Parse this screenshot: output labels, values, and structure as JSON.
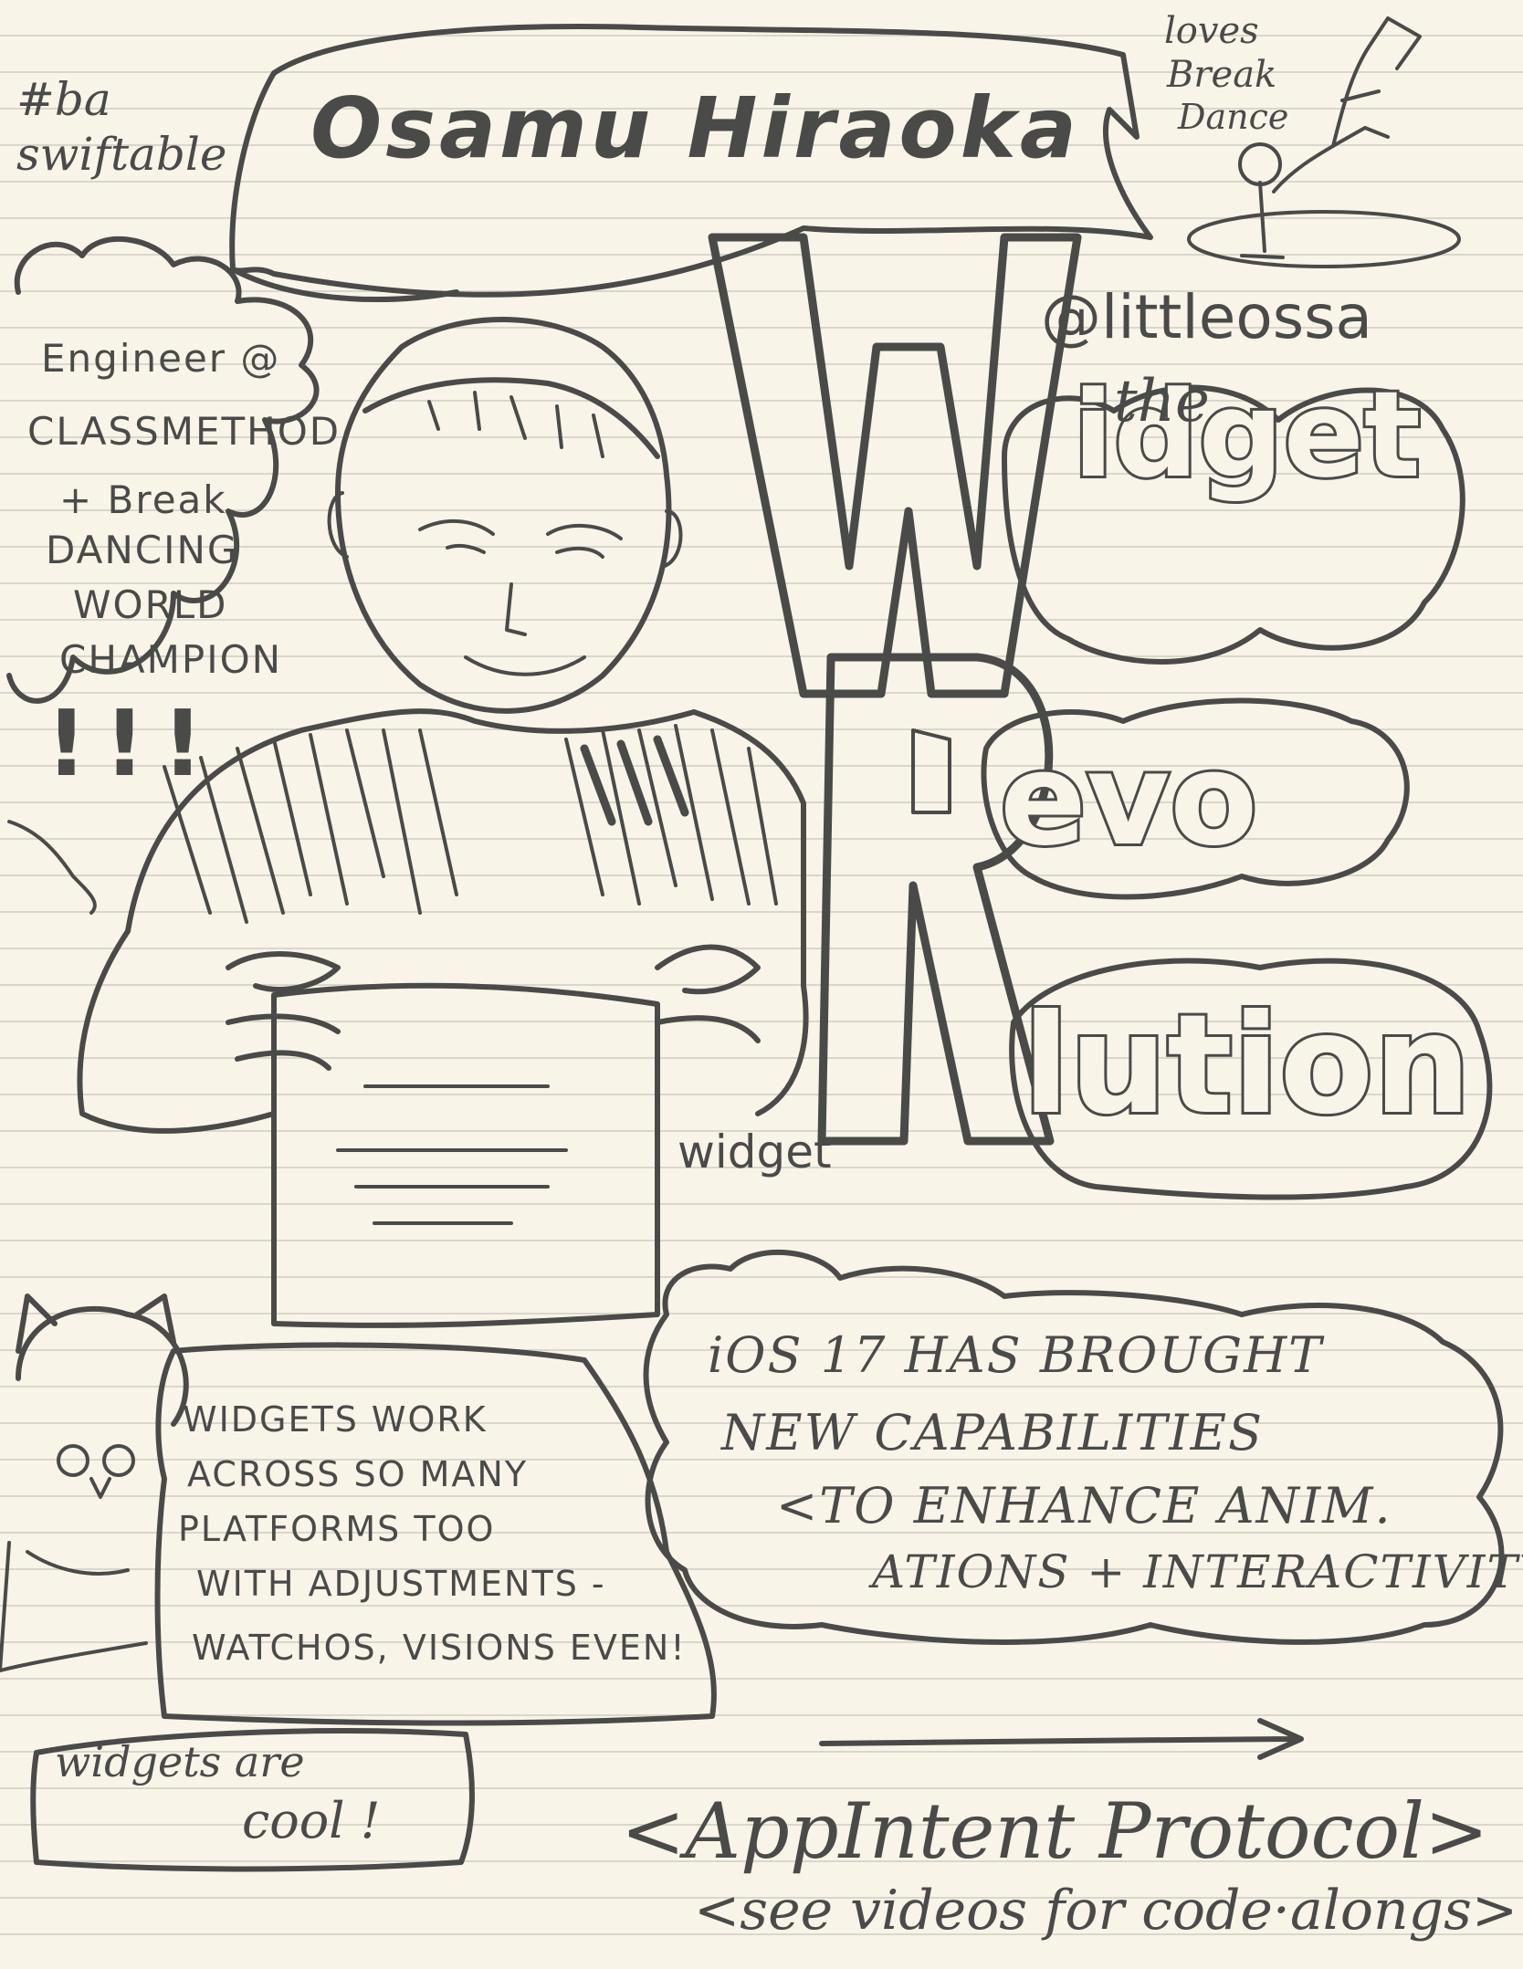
{
  "hashtag": [
    "#ba",
    "swiftable"
  ],
  "speaker_name": "Osamu Hiraoka",
  "loves": [
    "loves",
    "Break",
    "Dance"
  ],
  "handle": "@littleossa",
  "bio": [
    "Engineer @",
    "CLASSMETHOD",
    "+ Break",
    "DANCING",
    "WORLD",
    "CHAMPION"
  ],
  "exclaim": "!!!",
  "title": {
    "the": "the",
    "w": "W",
    "idget": "idget",
    "r": "R",
    "evo": "evo",
    "lution": "lution"
  },
  "widget_caption": "widget",
  "ios_note": [
    "iOS 17 HAS BROUGHT",
    "NEW CAPABILITIES",
    "<TO ENHANCE ANIM.",
    "ATIONS + INTERACTIVITY!"
  ],
  "platforms_note": [
    "WIDGETS WORK",
    "ACROSS SO MANY",
    "PLATFORMS TOO",
    "WITH ADJUSTMENTS -",
    "WATCHOS, VISIONS EVEN!"
  ],
  "cool_note": [
    "widgets are",
    "cool !"
  ],
  "appintent": "<AppIntent Protocol>",
  "videos_note": "<see videos for code·alongs>"
}
